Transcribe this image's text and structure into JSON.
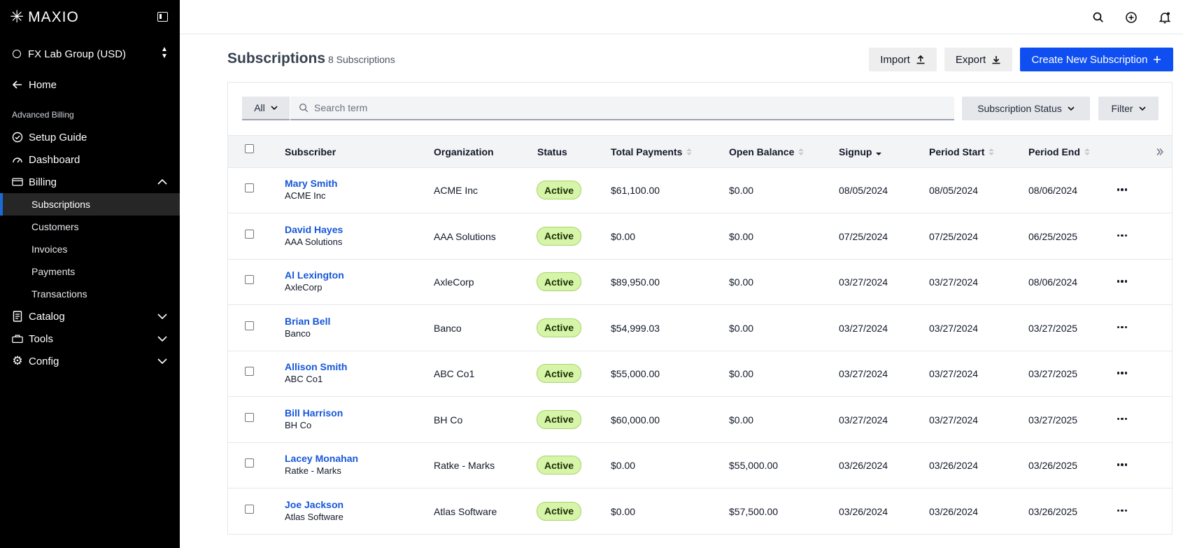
{
  "sidebar": {
    "logo_text": "MAXIO",
    "org_name": "FX Lab Group (USD)",
    "home_label": "Home",
    "section_label": "Advanced Billing",
    "items": [
      {
        "label": "Setup Guide"
      },
      {
        "label": "Dashboard"
      },
      {
        "label": "Billing",
        "expanded": true
      },
      {
        "label": "Catalog",
        "expanded": false
      },
      {
        "label": "Tools",
        "expanded": false
      },
      {
        "label": "Config",
        "expanded": false
      }
    ],
    "billing_children": [
      "Subscriptions",
      "Customers",
      "Invoices",
      "Payments",
      "Transactions"
    ],
    "active_child": "Subscriptions"
  },
  "topbar": {
    "icons": [
      "search-icon",
      "plus-circle-icon",
      "bell-icon"
    ]
  },
  "header": {
    "title": "Subscriptions",
    "count": "8 Subscriptions",
    "import_label": "Import",
    "export_label": "Export",
    "create_label": "Create New Subscription"
  },
  "filters": {
    "scope": "All",
    "search_placeholder": "Search term",
    "status_label": "Subscription Status",
    "filter_label": "Filter"
  },
  "table": {
    "columns": [
      "Subscriber",
      "Organization",
      "Status",
      "Total Payments",
      "Open Balance",
      "Signup",
      "Period Start",
      "Period End"
    ],
    "rows": [
      {
        "name": "Mary Smith",
        "sub_org": "ACME Inc",
        "organization": "ACME Inc",
        "status": "Active",
        "total": "$61,100.00",
        "balance": "$0.00",
        "signup": "08/05/2024",
        "start": "08/05/2024",
        "end": "08/06/2024"
      },
      {
        "name": "David Hayes",
        "sub_org": "AAA Solutions",
        "organization": "AAA Solutions",
        "status": "Active",
        "total": "$0.00",
        "balance": "$0.00",
        "signup": "07/25/2024",
        "start": "07/25/2024",
        "end": "06/25/2025"
      },
      {
        "name": "Al Lexington",
        "sub_org": "AxleCorp",
        "organization": "AxleCorp",
        "status": "Active",
        "total": "$89,950.00",
        "balance": "$0.00",
        "signup": "03/27/2024",
        "start": "03/27/2024",
        "end": "08/06/2024"
      },
      {
        "name": "Brian Bell",
        "sub_org": "Banco",
        "organization": "Banco",
        "status": "Active",
        "total": "$54,999.03",
        "balance": "$0.00",
        "signup": "03/27/2024",
        "start": "03/27/2024",
        "end": "03/27/2025"
      },
      {
        "name": "Allison Smith",
        "sub_org": "ABC Co1",
        "organization": "ABC Co1",
        "status": "Active",
        "total": "$55,000.00",
        "balance": "$0.00",
        "signup": "03/27/2024",
        "start": "03/27/2024",
        "end": "03/27/2025"
      },
      {
        "name": "Bill Harrison",
        "sub_org": "BH Co",
        "organization": "BH Co",
        "status": "Active",
        "total": "$60,000.00",
        "balance": "$0.00",
        "signup": "03/27/2024",
        "start": "03/27/2024",
        "end": "03/27/2025"
      },
      {
        "name": "Lacey Monahan",
        "sub_org": "Ratke - Marks",
        "organization": "Ratke - Marks",
        "status": "Active",
        "total": "$0.00",
        "balance": "$55,000.00",
        "signup": "03/26/2024",
        "start": "03/26/2024",
        "end": "03/26/2025"
      },
      {
        "name": "Joe Jackson",
        "sub_org": "Atlas Software",
        "organization": "Atlas Software",
        "status": "Active",
        "total": "$0.00",
        "balance": "$57,500.00",
        "signup": "03/26/2024",
        "start": "03/26/2024",
        "end": "03/26/2025"
      }
    ]
  },
  "colors": {
    "sidebar_bg": "#000000",
    "accent": "#0f4ef0",
    "link": "#1657d9",
    "badge_bg": "#d7f5a8"
  }
}
